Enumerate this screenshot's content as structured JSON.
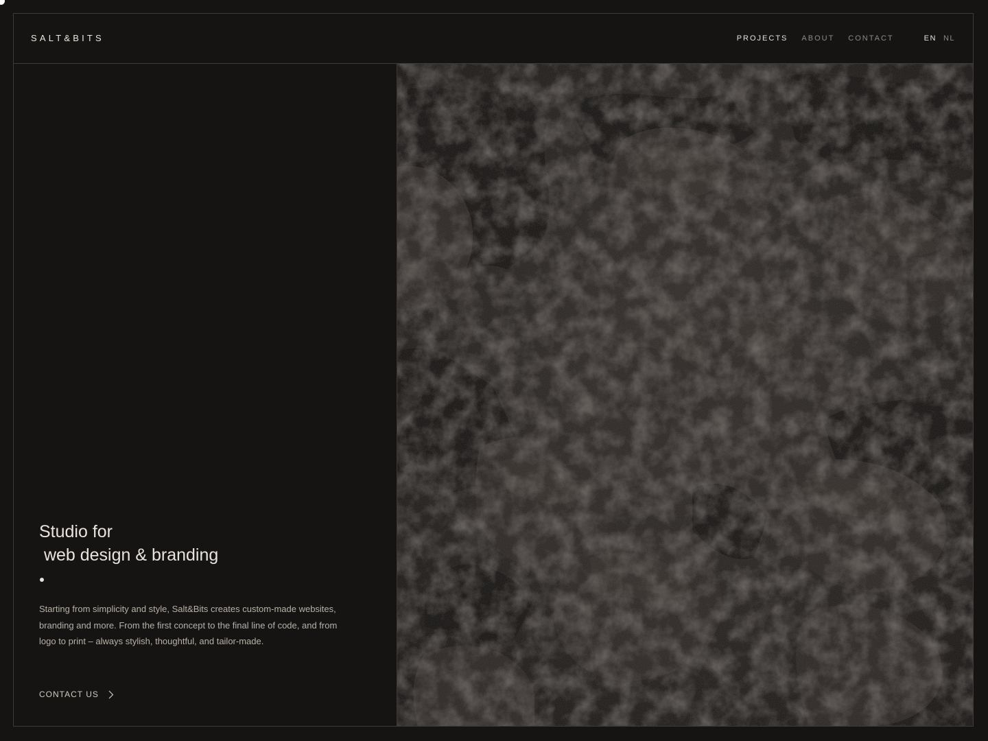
{
  "header": {
    "logo": "SALT&BITS",
    "nav": [
      {
        "label": "PROJECTS",
        "active": true
      },
      {
        "label": "ABOUT",
        "active": false
      },
      {
        "label": "CONTACT",
        "active": false
      }
    ],
    "languages": [
      {
        "label": "EN",
        "active": true
      },
      {
        "label": "NL",
        "active": false
      }
    ]
  },
  "hero": {
    "headline": "Studio for\n web design & branding",
    "description": "Starting from simplicity and style, Salt&Bits creates custom-made websites, branding and more. From the first concept to the final line of code, and from logo to print – always stylish, thoughtful, and tailor-made.",
    "cta_label": "CONTACT US",
    "cta_icon": "chevron-right-icon",
    "image": "dark-volcanic-rocks-photo"
  },
  "colors": {
    "background": "#161413",
    "border": "#3d3a37",
    "text_primary": "#e6e1da",
    "text_muted": "#8e8983"
  }
}
